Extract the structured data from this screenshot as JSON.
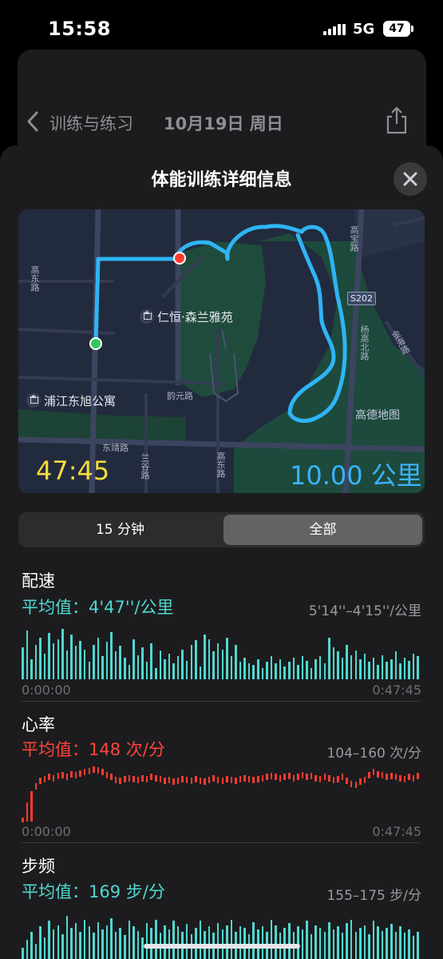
{
  "status": {
    "time": "15:58",
    "network": "5G",
    "battery": "47"
  },
  "background": {
    "back_label": "训练与练习",
    "date": "10月19日 周日"
  },
  "sheet": {
    "title": "体能训练详细信息"
  },
  "map": {
    "labels": {
      "poi1": "仁恒·森兰雅苑",
      "poi2": "浦江东旭公寓",
      "road1": "韵元路",
      "road2": "东靖路",
      "road3": "兰谷路",
      "road4": "高东路",
      "road5": "杨高北路",
      "road6": "金海路",
      "road7": "高宝路",
      "road8": "S202",
      "road9": "高德地图",
      "road10": "高东路"
    },
    "duration": "47:45",
    "distance": "10.00 公里"
  },
  "segment": {
    "options": [
      "15 分钟",
      "全部"
    ],
    "selected": "全部"
  },
  "pace": {
    "title": "配速",
    "avg": "平均值：4'47''/公里",
    "range": "5'14''–4'15''/公里",
    "start": "0:00:00",
    "end": "0:47:45",
    "color": "#4fd8d0",
    "bars": [
      0.55,
      0.85,
      0.35,
      0.6,
      0.72,
      0.45,
      0.8,
      0.62,
      0.7,
      0.88,
      0.5,
      0.78,
      0.58,
      0.66,
      0.52,
      0.3,
      0.6,
      0.72,
      0.4,
      0.65,
      0.82,
      0.48,
      0.58,
      0.38,
      0.25,
      0.7,
      0.42,
      0.55,
      0.3,
      0.62,
      0.2,
      0.5,
      0.35,
      0.45,
      0.28,
      0.4,
      0.52,
      0.32,
      0.6,
      0.68,
      0.22,
      0.78,
      0.7,
      0.48,
      0.62,
      0.52,
      0.72,
      0.4,
      0.6,
      0.3,
      0.38,
      0.28,
      0.25,
      0.35,
      0.2,
      0.3,
      0.4,
      0.28,
      0.35,
      0.22,
      0.3,
      0.38,
      0.25,
      0.4,
      0.32,
      0.2,
      0.35,
      0.4,
      0.28,
      0.72,
      0.55,
      0.48,
      0.38,
      0.6,
      0.42,
      0.5,
      0.35,
      0.45,
      0.3,
      0.38,
      0.25,
      0.42,
      0.3,
      0.35,
      0.48,
      0.28,
      0.38,
      0.32,
      0.45,
      0.4
    ],
    "hr_points": []
  },
  "heart": {
    "title": "心率",
    "avg": "平均值：148 次/分",
    "range": "104–160 次/分",
    "start": "0:00:00",
    "end": "0:47:45",
    "color": "#ff3b30",
    "bpm": [
      104,
      120,
      132,
      140,
      146,
      148,
      150,
      149,
      151,
      152,
      150,
      153,
      152,
      154,
      155,
      156,
      158,
      157,
      155,
      152,
      150,
      147,
      146,
      148,
      149,
      148,
      147,
      149,
      148,
      150,
      149,
      148,
      146,
      147,
      145,
      146,
      148,
      147,
      146,
      148,
      146,
      145,
      147,
      149,
      147,
      146,
      148,
      147,
      146,
      148,
      149,
      148,
      147,
      148,
      149,
      150,
      151,
      150,
      149,
      150,
      151,
      149,
      150,
      152,
      150,
      151,
      149,
      148,
      150,
      149,
      147,
      148,
      150,
      146,
      143,
      142,
      145,
      147,
      152,
      155,
      153,
      152,
      150,
      151,
      150,
      149,
      148,
      150,
      149,
      151
    ]
  },
  "cadence": {
    "title": "步频",
    "avg": "平均值：169 步/分",
    "range": "155–175 步/分",
    "color": "#4fd8d0",
    "bars": [
      0.2,
      0.35,
      0.5,
      0.28,
      0.6,
      0.4,
      0.7,
      0.55,
      0.62,
      0.45,
      0.8,
      0.58,
      0.66,
      0.5,
      0.72,
      0.6,
      0.48,
      0.68,
      0.55,
      0.62,
      0.75,
      0.5,
      0.58,
      0.44,
      0.7,
      0.6,
      0.52,
      0.4,
      0.66,
      0.58,
      0.72,
      0.48,
      0.62,
      0.55,
      0.7,
      0.6,
      0.5,
      0.64,
      0.45,
      0.58,
      0.7,
      0.52,
      0.6,
      0.48,
      0.66,
      0.55,
      0.62,
      0.72,
      0.5,
      0.6,
      0.58,
      0.45,
      0.68,
      0.55,
      0.6,
      0.5,
      0.72,
      0.62,
      0.48,
      0.58,
      0.66,
      0.5,
      0.6,
      0.55,
      0.7,
      0.45,
      0.62,
      0.58,
      0.5,
      0.68,
      0.55,
      0.6,
      0.48,
      0.66,
      0.72,
      0.5,
      0.58,
      0.62,
      0.45,
      0.7,
      0.6,
      0.52,
      0.58,
      0.65,
      0.5,
      0.6,
      0.48,
      0.55,
      0.42,
      0.5
    ]
  }
}
